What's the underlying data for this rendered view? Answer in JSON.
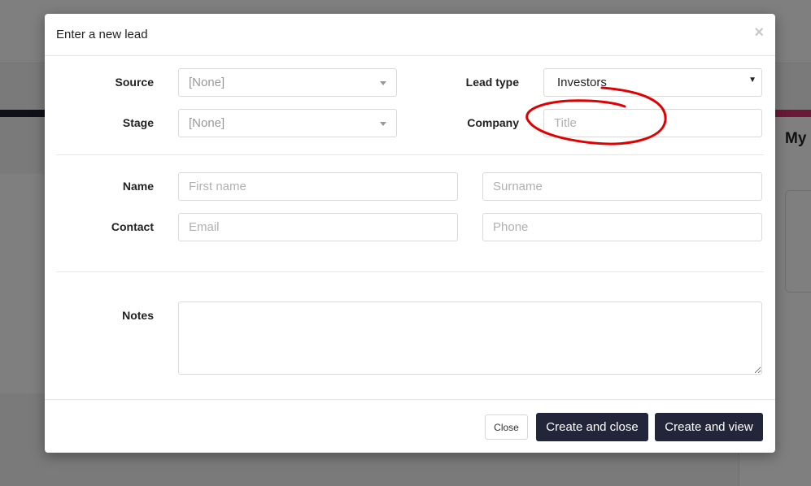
{
  "background": {
    "right_heading": "My"
  },
  "modal": {
    "title": "Enter a new lead",
    "close_icon": "×",
    "fields": {
      "source": {
        "label": "Source",
        "value": "[None]"
      },
      "stage": {
        "label": "Stage",
        "value": "[None]"
      },
      "lead_type": {
        "label": "Lead type",
        "value": "Investors"
      },
      "company": {
        "label": "Company",
        "placeholder": "Title"
      },
      "name": {
        "label": "Name",
        "first_placeholder": "First name",
        "surname_placeholder": "Surname"
      },
      "contact": {
        "label": "Contact",
        "email_placeholder": "Email",
        "phone_placeholder": "Phone"
      },
      "notes": {
        "label": "Notes",
        "value": ""
      }
    },
    "footer": {
      "close_label": "Close",
      "create_close_label": "Create and close",
      "create_view_label": "Create and view"
    }
  },
  "colors": {
    "primary_button": "#23263a",
    "annotation_red": "#e00000",
    "accent_pink": "#d6336c"
  },
  "icons": {
    "dropdown": "chevron-down-icon",
    "close": "close-icon"
  }
}
